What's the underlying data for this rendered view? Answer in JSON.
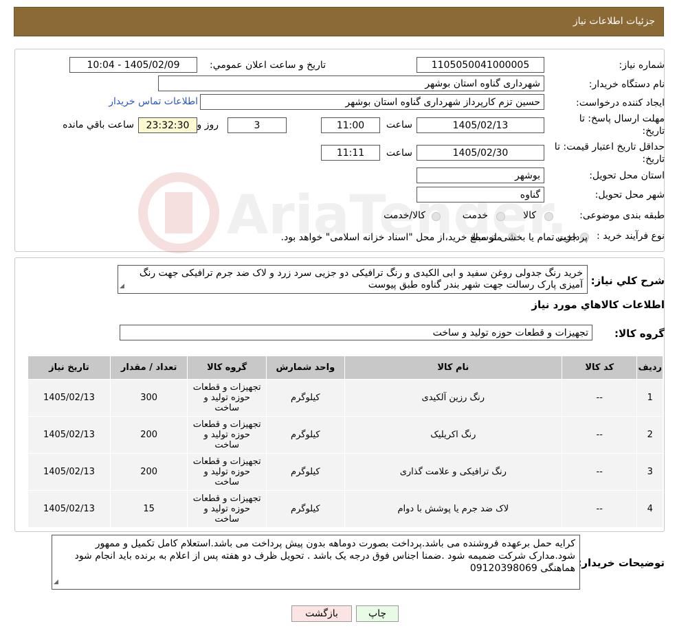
{
  "header": {
    "title": "جزئیات اطلاعات نیاز"
  },
  "form": {
    "need_number_label": "شماره نیاز:",
    "need_number": "1105050041000005",
    "announce_label": "تاریخ و ساعت اعلان عمومي:",
    "announce_value": "1405/02/09 - 10:04",
    "buyer_org_label": "نام دستگاه خريدار:",
    "buyer_org": "شهرداری گناوه استان بوشهر",
    "requester_label": "ايجاد کننده درخواست:",
    "requester": "حسین تزم کارپرداز شهرداری گناوه استان بوشهر",
    "contact_link": "اطلاعات تماس خريدار",
    "deadline_label_1": "مهلت ارسال پاسخ: تا",
    "deadline_label_2": "تاریخ:",
    "deadline_date": "1405/02/13",
    "time_label": "ساعت",
    "deadline_time": "11:00",
    "days_value": "3",
    "days_label": "روز و",
    "remaining_time": "23:32:30",
    "remaining_label": "ساعت باقي مانده",
    "validity_label_1": "حداقل تاريخ اعتبار قيمت: تا",
    "validity_label_2": "تاريخ:",
    "validity_date": "1405/02/30",
    "validity_time": "11:11",
    "province_label": "استان محل تحويل:",
    "province": "بوشهر",
    "city_label": "شهر محل تحويل:",
    "city": "گناوه",
    "category_label": "طبقه بندی موضوعی:",
    "category_options": [
      "کالا",
      "خدمت",
      "کالا/خدمت"
    ],
    "process_label": "نوع فرآیند خرید :",
    "process_options": [
      "جزیی",
      "متوسط"
    ],
    "process_note": "پرداخت تمام يا بخشی از مبلغ خريد،از محل \"اسناد خزانه اسلامی\" خواهد بود."
  },
  "description": {
    "label": "شرح کلي نياز:",
    "text": "خرید رنگ  جدولی روغن سفید و ابی الکیدی و رنگ ترافیکی دو جزیی سرد زرد و لاک ضد جرم ترافیکی  جهت رنگ آمیزی پارک رسالت  جهت شهر بندر گناوه طبق پیوست"
  },
  "goods": {
    "section_title": "اطلاعات کالاهاي مورد نياز",
    "group_label": "گروه کالا:",
    "group_value": "تجهیزات و قطعات حوزه تولید و ساخت",
    "columns": [
      "رديف",
      "کد کالا",
      "نام کالا",
      "واحد شمارش",
      "گروه کالا",
      "تعداد / مقدار",
      "تاريخ نياز"
    ],
    "rows": [
      {
        "idx": "1",
        "code": "--",
        "name": "رنگ رزین آلکیدی",
        "unit": "کیلوگرم",
        "group": "تجهیزات و قطعات حوزه تولید و ساخت",
        "qty": "300",
        "date": "1405/02/13"
      },
      {
        "idx": "2",
        "code": "--",
        "name": "رنگ اکریلیک",
        "unit": "کیلوگرم",
        "group": "تجهیزات و قطعات حوزه تولید و ساخت",
        "qty": "200",
        "date": "1405/02/13"
      },
      {
        "idx": "3",
        "code": "--",
        "name": "رنگ ترافیکی و علامت گذاری",
        "unit": "کیلوگرم",
        "group": "تجهیزات و قطعات حوزه تولید و ساخت",
        "qty": "200",
        "date": "1405/02/13"
      },
      {
        "idx": "4",
        "code": "--",
        "name": "لاک ضد جرم یا پوشش با دوام",
        "unit": "کیلوگرم",
        "group": "تجهیزات و قطعات حوزه تولید و ساخت",
        "qty": "15",
        "date": "1405/02/13"
      }
    ]
  },
  "buyer_notes": {
    "label": "توضیحات خریدار:",
    "text": "کرایه حمل برعهده فروشنده می باشد.پرداخت بصورت دوماهه بدون پیش پرداخت می باشد.استعلام کامل تکمیل و ممهور شود.مدارک شرکت ضمیمه شود .ضمنا اجناس فوق درجه یک باشد . تحویل ظرف دو هفته پس از اعلام به برنده باید انجام شود هماهنگی 09120398069"
  },
  "buttons": {
    "print": "چاپ",
    "back": "بازگشت"
  },
  "watermark": {
    "text": "AriaTender.neT"
  }
}
